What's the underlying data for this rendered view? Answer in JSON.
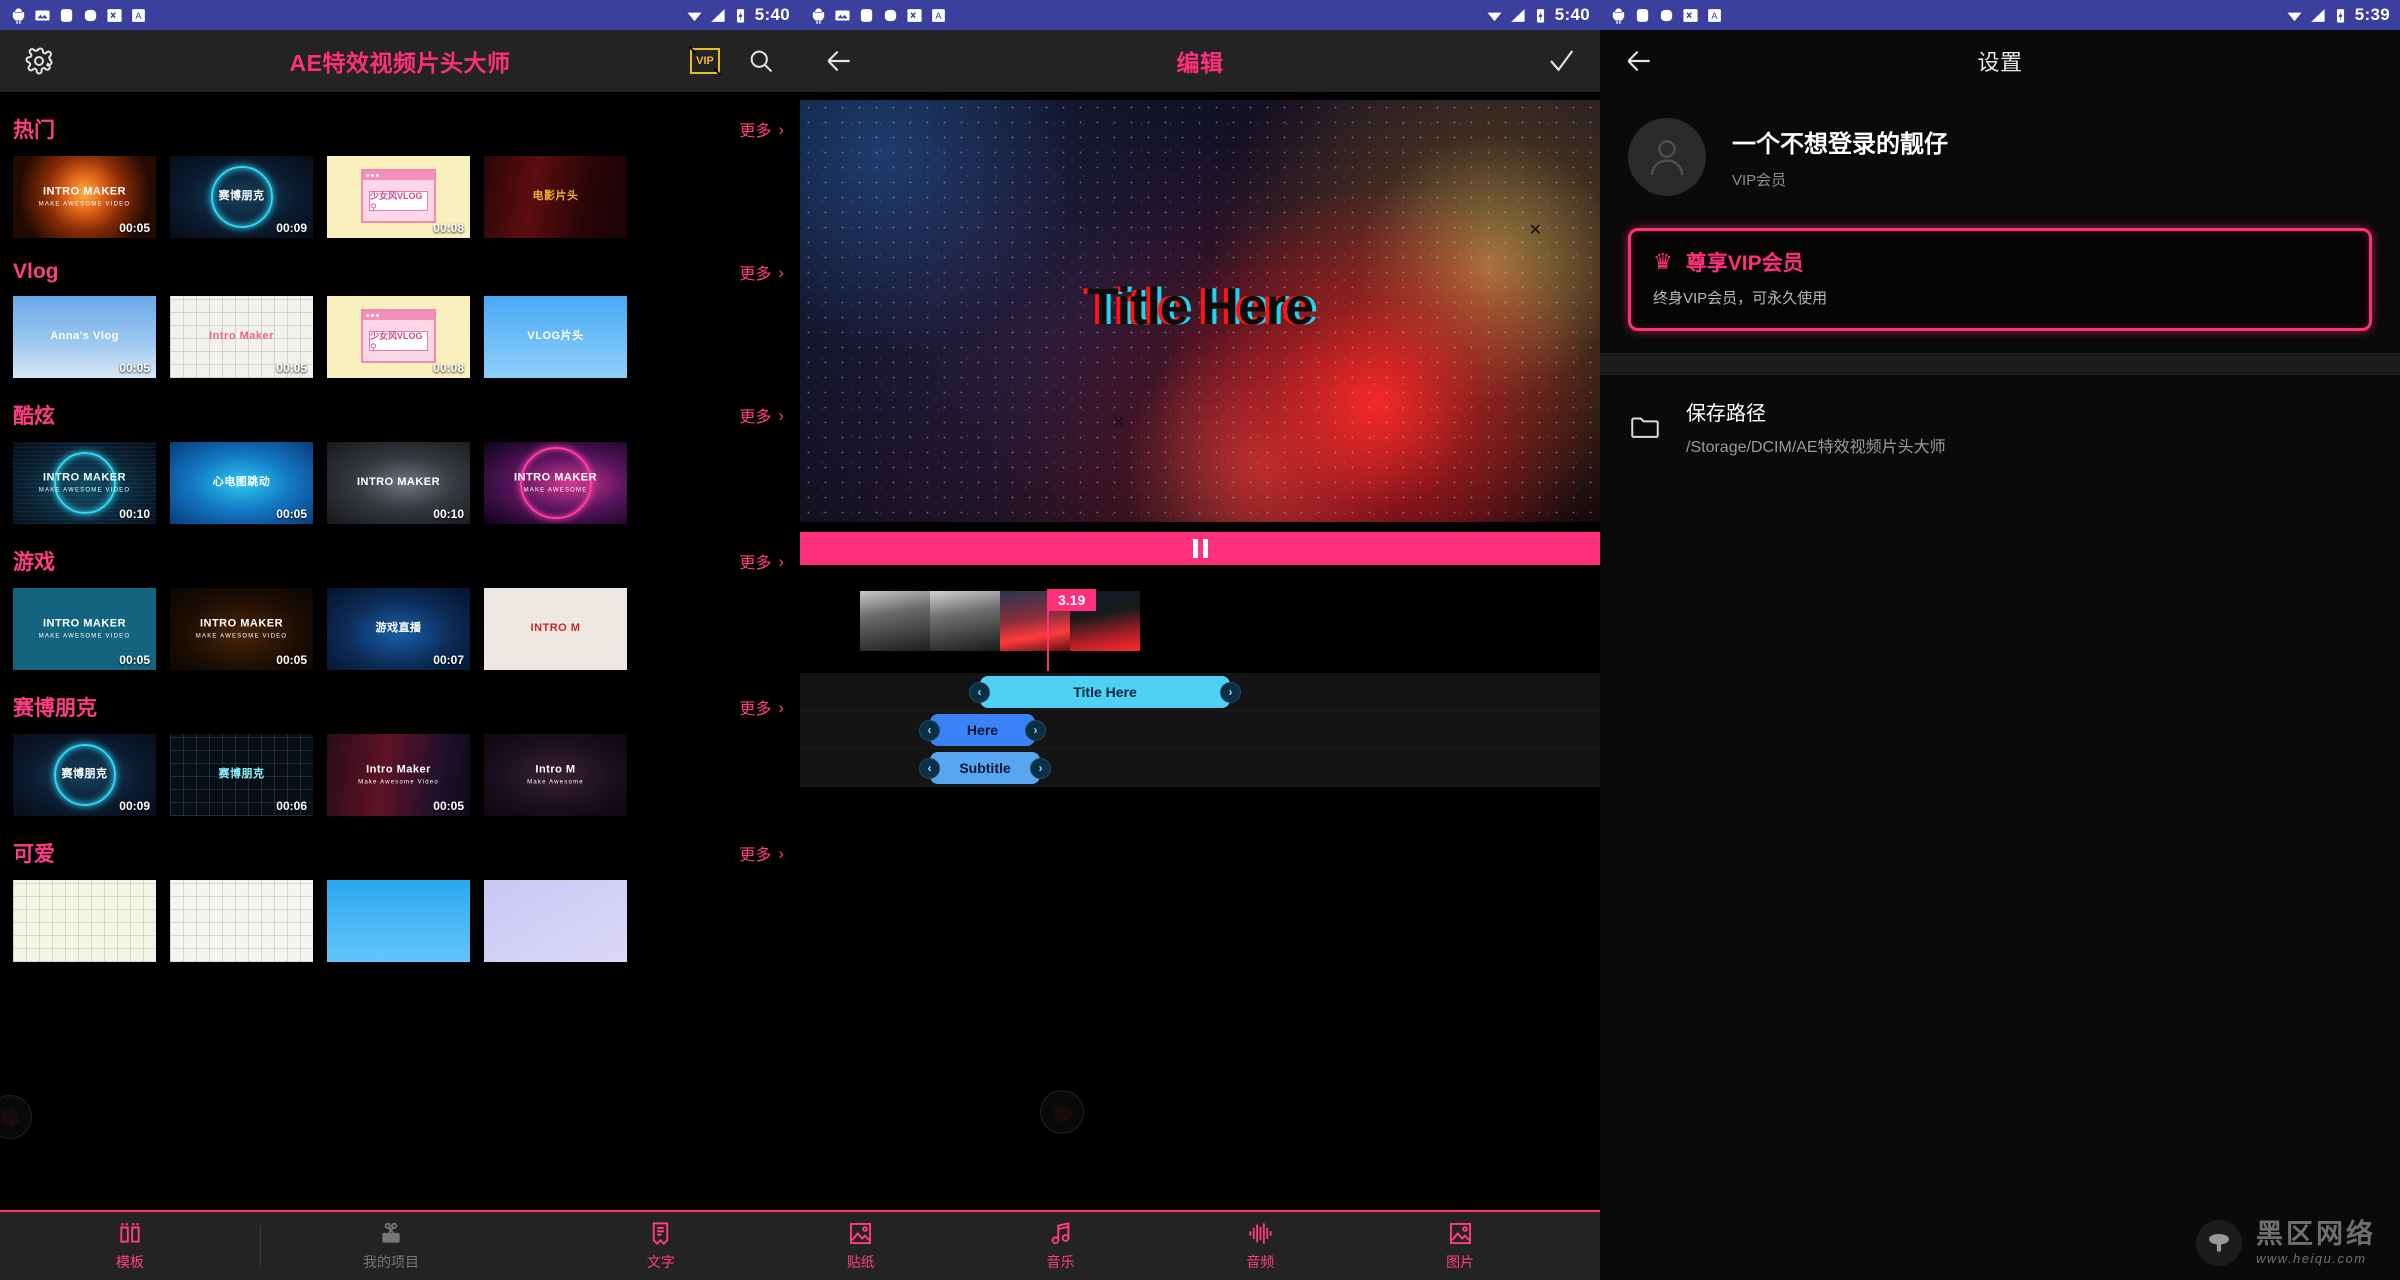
{
  "statusbar": {
    "time_left": "5:40",
    "time_mid": "5:40",
    "time_right": "5:39",
    "icons": [
      "android-icon",
      "image-icon",
      "app-icon",
      "app-icon",
      "translate-icon",
      "font-icon"
    ]
  },
  "templates_panel": {
    "header": {
      "title": "AE特效视频片头大师",
      "settings_icon": "gear-icon",
      "vip_label": "VIP",
      "search_icon": "search-icon"
    },
    "more_label": "更多",
    "categories": [
      {
        "title": "热门",
        "items": [
          {
            "label": "INTRO MAKER",
            "sublabel": "MAKE AWESOME VIDEO",
            "duration": "00:05",
            "art": "bg-fire",
            "color": "#ffffff"
          },
          {
            "label": "赛博朋克",
            "sublabel": "",
            "duration": "00:09",
            "art": "bg-cyber",
            "color": "#ffffff"
          },
          {
            "label": "少女风VLOG",
            "sublabel": "",
            "duration": "00:08",
            "art": "bg-vlogwin",
            "color": "#d14a86"
          },
          {
            "label": "电影片头",
            "sublabel": "",
            "duration": "",
            "art": "bg-curtain",
            "color": "#f0b429"
          }
        ]
      },
      {
        "title": "Vlog",
        "items": [
          {
            "label": "Anna's Vlog",
            "sublabel": "",
            "duration": "00:05",
            "art": "bg-skyrec",
            "color": "#ffffff"
          },
          {
            "label": "Intro Maker",
            "sublabel": "",
            "duration": "00:05",
            "art": "bg-leaf",
            "color": "#f06292"
          },
          {
            "label": "少女风VLOG",
            "sublabel": "",
            "duration": "00:08",
            "art": "bg-vlogwin",
            "color": "#d14a86"
          },
          {
            "label": "VLOG片头",
            "sublabel": "",
            "duration": "",
            "art": "bg-skyblue",
            "color": "#ffffff"
          }
        ]
      },
      {
        "title": "酷炫",
        "items": [
          {
            "label": "INTRO MAKER",
            "sublabel": "MAKE AWESOME VIDEO",
            "duration": "00:10",
            "art": "bg-hud",
            "color": "#eafcff"
          },
          {
            "label": "心电图跳动",
            "sublabel": "",
            "duration": "00:05",
            "art": "bg-ecg",
            "color": "#ffffff"
          },
          {
            "label": "INTRO MAKER",
            "sublabel": "",
            "duration": "00:10",
            "art": "bg-globe",
            "color": "#ffffff"
          },
          {
            "label": "INTRO MAKER",
            "sublabel": "MAKE AWESOME",
            "duration": "",
            "art": "bg-neonpk",
            "color": "#ffffff"
          }
        ]
      },
      {
        "title": "游戏",
        "items": [
          {
            "label": "INTRO MAKER",
            "sublabel": "MAKE AWESOME VIDEO",
            "duration": "00:05",
            "art": "bg-teal",
            "color": "#ffffff"
          },
          {
            "label": "INTRO MAKER",
            "sublabel": "MAKE AWESOME VIDEO",
            "duration": "00:05",
            "art": "bg-pad",
            "color": "#ffffff"
          },
          {
            "label": "游戏直播",
            "sublabel": "",
            "duration": "00:07",
            "art": "bg-gamelv",
            "color": "#ffffff"
          },
          {
            "label": "INTRO M",
            "sublabel": "",
            "duration": "",
            "art": "bg-stripe",
            "color": "#c62828"
          }
        ]
      },
      {
        "title": "赛博朋克",
        "items": [
          {
            "label": "赛博朋克",
            "sublabel": "",
            "duration": "00:09",
            "art": "bg-cyber",
            "color": "#ffffff"
          },
          {
            "label": "赛博朋克",
            "sublabel": "",
            "duration": "00:06",
            "art": "bg-cyber2",
            "color": "#8df3ff"
          },
          {
            "label": "Intro Maker",
            "sublabel": "Make Awesome Video",
            "duration": "00:05",
            "art": "bg-glitch",
            "color": "#ffffff"
          },
          {
            "label": "Intro M",
            "sublabel": "Make Awesome",
            "duration": "",
            "art": "bg-hex",
            "color": "#ffffff"
          }
        ]
      },
      {
        "title": "可爱",
        "items": [
          {
            "label": "",
            "sublabel": "",
            "duration": "",
            "art": "bg-peach",
            "color": "#888888"
          },
          {
            "label": "",
            "sublabel": "",
            "duration": "",
            "art": "bg-grid",
            "color": "#888888"
          },
          {
            "label": "",
            "sublabel": "",
            "duration": "",
            "art": "bg-cloud",
            "color": "#ffffff"
          },
          {
            "label": "",
            "sublabel": "",
            "duration": "",
            "art": "bg-lav",
            "color": "#888888"
          }
        ]
      }
    ]
  },
  "bottom_nav": {
    "items": [
      {
        "label": "模板",
        "icon": "template-icon",
        "state": "active"
      },
      {
        "label": "我的项目",
        "icon": "scissors-camera-icon",
        "state": "inactive"
      },
      {
        "label": "文字",
        "icon": "text-icon",
        "state": "active"
      },
      {
        "label": "贴纸",
        "icon": "sticker-icon",
        "state": "active"
      },
      {
        "label": "音乐",
        "icon": "music-note-icon",
        "state": "active"
      },
      {
        "label": "音频",
        "icon": "waveform-icon",
        "state": "active"
      },
      {
        "label": "图片",
        "icon": "image-icon",
        "state": "active"
      }
    ]
  },
  "editor_panel": {
    "header": {
      "title": "编辑",
      "back_icon": "back-arrow-icon",
      "confirm_icon": "check-icon"
    },
    "preview": {
      "title_text": "Title Here"
    },
    "playback": {
      "state_icon": "pause-icon"
    },
    "timeline": {
      "current_time": "3.19",
      "tracks": [
        {
          "clip_label": "Title Here",
          "color": "#4fd0f5"
        },
        {
          "clip_label": "Here",
          "color": "#3b82f6"
        },
        {
          "clip_label": "Subtitle",
          "color": "#58a6f0"
        }
      ]
    }
  },
  "settings_panel": {
    "header": {
      "title": "设置",
      "back_icon": "back-arrow-icon"
    },
    "profile": {
      "name": "一个不想登录的靓仔",
      "membership": "VIP会员",
      "avatar_icon": "person-icon"
    },
    "vip_card": {
      "title": "尊享VIP会员",
      "subtitle": "终身VIP会员，可永久使用",
      "icon": "crown-icon"
    },
    "save_path": {
      "title": "保存路径",
      "value": "/Storage/DCIM/AE特效视频片头大师",
      "icon": "folder-icon"
    }
  },
  "watermark": {
    "name": "黑区网络",
    "url": "www.heiqu.com",
    "logo_icon": "mushroom-logo-icon"
  },
  "colors": {
    "accent_pink": "#ff2f7b",
    "statusbar_blue": "#3b3f9e",
    "clip_cyan": "#4fd0f5",
    "vip_gold": "#e8c022"
  }
}
